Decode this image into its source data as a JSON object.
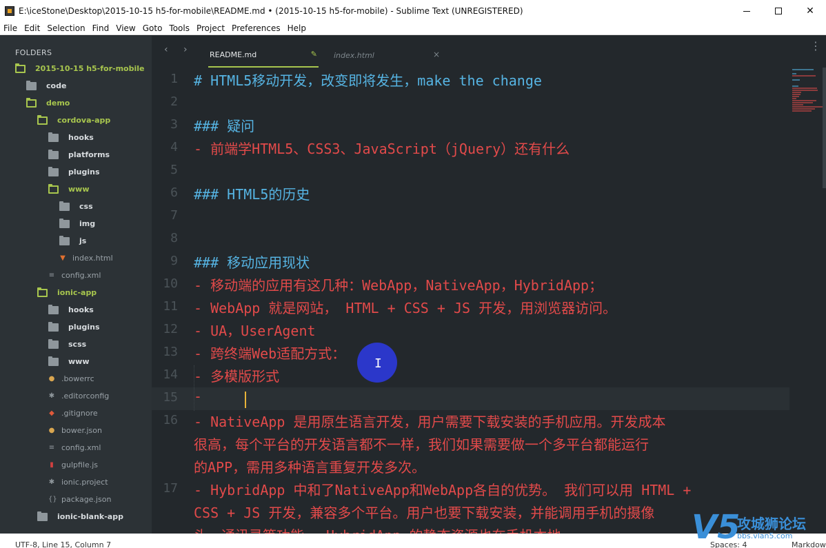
{
  "window": {
    "title": "E:\\iceStone\\Desktop\\2015-10-15 h5-for-mobile\\README.md • (2015-10-15 h5-for-mobile) - Sublime Text (UNREGISTERED)",
    "minimize_glyph": "—",
    "close_glyph": "✕"
  },
  "menu": [
    "File",
    "Edit",
    "Selection",
    "Find",
    "View",
    "Goto",
    "Tools",
    "Project",
    "Preferences",
    "Help"
  ],
  "sidebar": {
    "header": "FOLDERS",
    "items": [
      {
        "label": "2015-10-15 h5-for-mobile",
        "kind": "folder-open",
        "depth": 0,
        "icon": "folder-open-icon"
      },
      {
        "label": "code",
        "kind": "folder",
        "depth": 1,
        "icon": "folder-icon"
      },
      {
        "label": "demo",
        "kind": "folder-open",
        "depth": 1,
        "icon": "folder-open-icon"
      },
      {
        "label": "cordova-app",
        "kind": "folder-open",
        "depth": 2,
        "icon": "folder-open-icon"
      },
      {
        "label": "hooks",
        "kind": "folder",
        "depth": 3,
        "icon": "folder-icon"
      },
      {
        "label": "platforms",
        "kind": "folder",
        "depth": 3,
        "icon": "folder-icon"
      },
      {
        "label": "plugins",
        "kind": "folder",
        "depth": 3,
        "icon": "folder-icon"
      },
      {
        "label": "www",
        "kind": "folder-open",
        "depth": 3,
        "icon": "folder-open-icon"
      },
      {
        "label": "css",
        "kind": "folder",
        "depth": 4,
        "icon": "folder-icon"
      },
      {
        "label": "img",
        "kind": "folder",
        "depth": 4,
        "icon": "folder-icon"
      },
      {
        "label": "js",
        "kind": "folder",
        "depth": 4,
        "icon": "folder-icon"
      },
      {
        "label": "index.html",
        "kind": "file",
        "depth": 4,
        "icon": "html5-icon",
        "glyph": "▼"
      },
      {
        "label": "config.xml",
        "kind": "file",
        "depth": 3,
        "icon": "xml-file-icon",
        "glyph": "≡"
      },
      {
        "label": "ionic-app",
        "kind": "folder-open",
        "depth": 2,
        "icon": "folder-open-icon"
      },
      {
        "label": "hooks",
        "kind": "folder",
        "depth": 3,
        "icon": "folder-icon"
      },
      {
        "label": "plugins",
        "kind": "folder",
        "depth": 3,
        "icon": "folder-icon"
      },
      {
        "label": "scss",
        "kind": "folder",
        "depth": 3,
        "icon": "folder-icon"
      },
      {
        "label": "www",
        "kind": "folder",
        "depth": 3,
        "icon": "folder-icon"
      },
      {
        "label": ".bowerrc",
        "kind": "file",
        "depth": 3,
        "icon": "bower-icon",
        "glyph": "●"
      },
      {
        "label": ".editorconfig",
        "kind": "file",
        "depth": 3,
        "icon": "gear-icon",
        "glyph": "✱"
      },
      {
        "label": ".gitignore",
        "kind": "file",
        "depth": 3,
        "icon": "git-icon",
        "glyph": "◆"
      },
      {
        "label": "bower.json",
        "kind": "file",
        "depth": 3,
        "icon": "bower-icon",
        "glyph": "●"
      },
      {
        "label": "config.xml",
        "kind": "file",
        "depth": 3,
        "icon": "xml-file-icon",
        "glyph": "≡"
      },
      {
        "label": "gulpfile.js",
        "kind": "file",
        "depth": 3,
        "icon": "gulp-icon",
        "glyph": "▮"
      },
      {
        "label": "ionic.project",
        "kind": "file",
        "depth": 3,
        "icon": "gear-icon",
        "glyph": "✱"
      },
      {
        "label": "package.json",
        "kind": "file",
        "depth": 3,
        "icon": "json-file-icon",
        "glyph": "{}"
      },
      {
        "label": "ionic-blank-app",
        "kind": "folder",
        "depth": 2,
        "icon": "folder-icon"
      }
    ]
  },
  "tabs": [
    {
      "label": "README.md",
      "active": true,
      "glyph": "✎"
    },
    {
      "label": "index.html",
      "active": false,
      "glyph": "×"
    }
  ],
  "nav": {
    "back": "‹",
    "forward": "›",
    "more": "⋮"
  },
  "editor": {
    "lines": [
      {
        "no": "1",
        "text": "# HTML5移动开发，改变即将发生，make the change",
        "style": "h"
      },
      {
        "no": "2",
        "text": "",
        "style": "h"
      },
      {
        "no": "3",
        "text": "### 疑问",
        "style": "h"
      },
      {
        "no": "4",
        "text": "- 前端学HTML5、CSS3、JavaScript（jQuery）还有什么",
        "style": "r"
      },
      {
        "no": "5",
        "text": "",
        "style": "h"
      },
      {
        "no": "6",
        "text": "### HTML5的历史",
        "style": "h"
      },
      {
        "no": "7",
        "text": "",
        "style": "h"
      },
      {
        "no": "8",
        "text": "",
        "style": "h"
      },
      {
        "no": "9",
        "text": "### 移动应用现状",
        "style": "h"
      },
      {
        "no": "10",
        "text": "- 移动端的应用有这几种：WebApp，NativeApp，HybridApp；",
        "style": "r"
      },
      {
        "no": "11",
        "text": "- WebApp 就是网站， HTML + CSS + JS 开发，用浏览器访问。",
        "style": "r"
      },
      {
        "no": "12",
        "text": "- UA，UserAgent",
        "style": "r"
      },
      {
        "no": "13",
        "text": "- 跨终端Web适配方式：",
        "style": "r"
      },
      {
        "no": "14",
        "text": "    - 多模版形式",
        "style": "r"
      },
      {
        "no": "15",
        "text": "    -",
        "style": "r"
      },
      {
        "no": "16",
        "text": "- NativeApp 是用原生语言开发，用户需要下载安装的手机应用。开发成本",
        "style": "r"
      },
      {
        "no": "",
        "text": "很高，每个平台的开发语言都不一样，我们如果需要做一个多平台都能运行",
        "style": "r"
      },
      {
        "no": "",
        "text": "的APP，需用多种语言重复开发多次。",
        "style": "r"
      },
      {
        "no": "17",
        "text": "- HybridApp 中和了NativeApp和WebApp各自的优势。 我们可以用 HTML +",
        "style": "r"
      },
      {
        "no": "",
        "text": "CSS + JS 开发，兼容多个平台。用户也要下载安装，并能调用手机的摄像",
        "style": "r"
      },
      {
        "no": "",
        "text": "头、通讯录等功能。 HybridApp 的静态资源也在手机本地",
        "style": "r"
      }
    ],
    "current_line_index": 14,
    "ibeam_glyph": "I"
  },
  "status": {
    "position": "UTF-8, Line 15, Column 7",
    "spaces": "Spaces: 4",
    "syntax": "Markdown"
  },
  "watermark": {
    "logo": "V5",
    "name": "攻城狮论坛",
    "url": "bbs.vlan5.com"
  },
  "colors": {
    "heading": "#56b4e3",
    "list": "#e24a4a",
    "accent": "#a8c64e",
    "cursor": "#e8b33a",
    "click_marker": "#2d38d8"
  }
}
